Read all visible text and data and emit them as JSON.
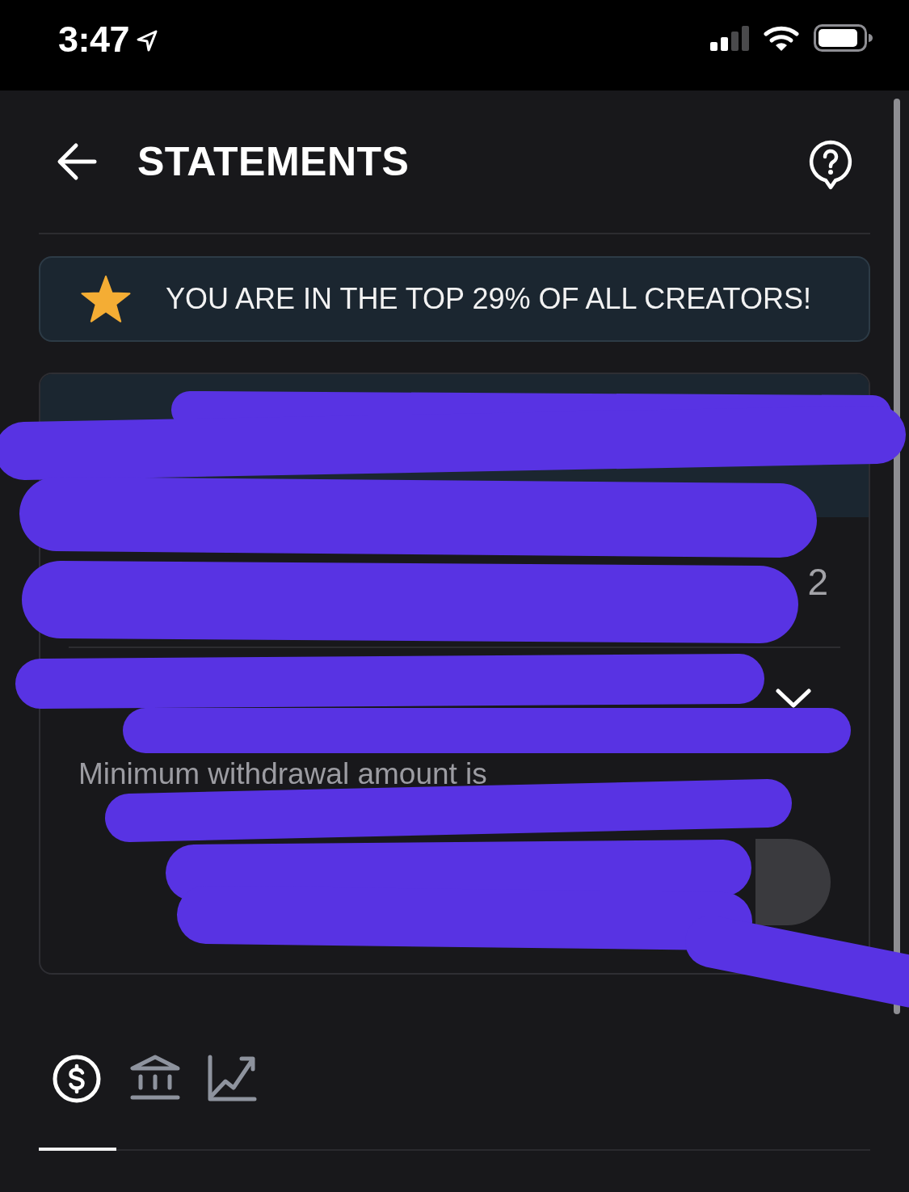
{
  "status_bar": {
    "time": "3:47"
  },
  "header": {
    "title": "STATEMENTS"
  },
  "banner": {
    "text": "YOU ARE IN THE TOP 29% OF ALL CREATORS!"
  },
  "card": {
    "value_fragment": "2",
    "note": "Minimum withdrawal amount is"
  },
  "tabs": [
    {
      "kind": "dollar",
      "selected": true
    },
    {
      "kind": "bank",
      "selected": false
    },
    {
      "kind": "chart",
      "selected": false
    }
  ]
}
